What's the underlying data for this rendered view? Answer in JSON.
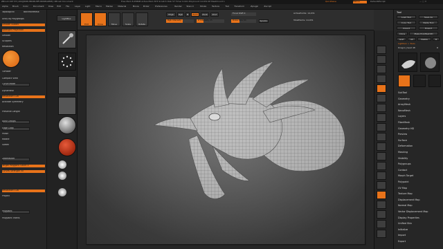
{
  "app": {
    "title": "ZBrush 4R7 P3 (x64)[R0RU8R0RU8FUR0K8GRM8]:  ZBrush Document",
    "mem": "Free Mem 8.258KB  Active Mem 873  Scratch Disk 57  Timer 0.001  PolyCount 14.031 KP  MeshCount 1",
    "quicksave": "QuickSave",
    "menus_label": "Menus",
    "default_script": "DefaultZScript"
  },
  "menubar": [
    "Alpha",
    "Brush",
    "Color",
    "Document",
    "Draw",
    "Edit",
    "File",
    "Layer",
    "Light",
    "Macro",
    "Marker",
    "Material",
    "Movie",
    "Picker",
    "Preferences",
    "Render",
    "Stencil",
    "Stroke",
    "Texture",
    "Tool",
    "Transform",
    "Zplugin",
    "Zscript"
  ],
  "leftpanel": {
    "header": "Topological",
    "backface": "BackfaceMask",
    "items": [
      {
        "label": "Unify By Polygroups",
        "style": "text"
      },
      {
        "label": "Smooth Subdiv",
        "style": "orange"
      },
      {
        "label": "Spotlight Projection",
        "style": "orange"
      },
      {
        "label": "Smooth",
        "style": "text"
      },
      {
        "label": "Sculptris",
        "style": "text"
      },
      {
        "label": "Resolution",
        "style": "text"
      },
      {
        "label": "Tumbler",
        "style": "text"
      },
      {
        "label": "Compact View",
        "style": "text"
      },
      {
        "label": "Curve Mode",
        "style": "dark"
      },
      {
        "label": "Dynamesh",
        "style": "text"
      },
      {
        "label": "Resolution 128",
        "style": "orange"
      },
      {
        "label": "Activate Symmetry",
        "style": "text"
      },
      {
        "label": "Preserve Length",
        "style": "text"
      },
      {
        "label": "Auto Groups",
        "style": "dark"
      },
      {
        "label": "Edge Loop",
        "style": "dark"
      },
      {
        "label": "Polish",
        "style": "text"
      },
      {
        "label": "Rotate",
        "style": "text"
      },
      {
        "label": "Soften",
        "style": "text"
      },
      {
        "label": "ZRemesher",
        "style": "dark"
      },
      {
        "label": "Target Polygons Count 5",
        "style": "orange"
      },
      {
        "label": "Curves Strength 50",
        "style": "orange"
      },
      {
        "label": "Resolution 128",
        "style": "orange"
      },
      {
        "label": "Project",
        "style": "text"
      },
      {
        "label": "Polypaint",
        "style": "dark"
      },
      {
        "label": "Polypaint Intens",
        "style": "text"
      }
    ]
  },
  "lefttools": {
    "lightbox": "LightBox",
    "labels": [
      "Lazy",
      "Dots",
      "Alpha Off",
      "Texture Off",
      "MatCap Gray",
      "Gradient",
      "SwitchColor",
      "Alternate"
    ]
  },
  "topbar": {
    "buttons": [
      "Edit",
      "Draw",
      "Move",
      "Scale",
      "Rotate"
    ],
    "mrgb": "Mrgb",
    "rgb": "Rgb",
    "m": "M",
    "zadd": "Zadd",
    "zsub": "Zsub",
    "zcut": "Zcut",
    "focal_shift": "Focal Shift 0",
    "rgb_intensity": "Rgb Intensity",
    "z_intensity": "Z Intensity 25",
    "draw_size": "Draw Size 64",
    "dynamic": "Dynamic",
    "activepoints": "ActivePoints: 14,031",
    "totalpoints": "TotalPoints: 14,031"
  },
  "righttools": {
    "icons": [
      "bpr-icon",
      "spix-icon",
      "scroll-icon",
      "zoom-icon",
      "actual-icon",
      "aahalf-icon",
      "persp-icon",
      "floor-icon",
      "local-icon",
      "xyz-icon",
      "frame-icon",
      "move-icon",
      "scale-icon",
      "rotate-icon",
      "linefill-icon",
      "polyf-icon",
      "transp-icon",
      "ghost-icon",
      "solo-icon",
      "xpose-icon"
    ]
  },
  "rightpanel": {
    "title": "Tool",
    "buttons": [
      "Load Tool",
      "Save As",
      "Copy Tool",
      "Paste Tool",
      "Import",
      "Export",
      "Clone",
      "Make PolyMesh3D",
      "GoZ",
      "All",
      "Visible",
      "R"
    ],
    "lightbox_tools": "Lightbox > Tools",
    "tool_name": "Dragon_head 48",
    "r_label": "R",
    "subtools": [
      "Dragon_head",
      "SimpleBrush",
      "Dragon_head"
    ],
    "sections": [
      "SubTool",
      "Geometry",
      "ArrayMesh",
      "NanoMesh",
      "Layers",
      "FiberMesh",
      "Geometry HD",
      "Preview",
      "Surface",
      "Deformation",
      "Masking",
      "Visibility",
      "Polygroups",
      "Contact",
      "Morph Target",
      "Polypaint",
      "UV Map",
      "Texture Map",
      "Displacement Map",
      "Normal Map",
      "Vector Displacement Map",
      "Display Properties",
      "Unified Skin",
      "Initialize",
      "Import",
      "Export"
    ]
  },
  "colors": {
    "accent": "#e8731a",
    "bg": "#2a2a2a",
    "panel": "#262626"
  }
}
